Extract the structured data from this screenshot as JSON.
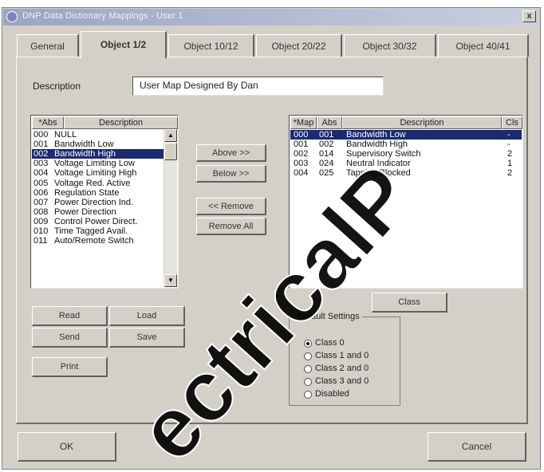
{
  "window": {
    "title": "DNP Data Dictionary Mappings - User 1",
    "close_label": "x"
  },
  "tabs": [
    {
      "label": "General"
    },
    {
      "label": "Object 1/2"
    },
    {
      "label": "Object 10/12"
    },
    {
      "label": "Object 20/22"
    },
    {
      "label": "Object 30/32"
    },
    {
      "label": "Object 40/41"
    }
  ],
  "description": {
    "label": "Description",
    "value": "User Map Designed By Dan"
  },
  "source_list": {
    "columns": [
      "*Abs",
      "Description"
    ],
    "rows": [
      {
        "abs": "000",
        "desc": "NULL"
      },
      {
        "abs": "001",
        "desc": "Bandwidth Low"
      },
      {
        "abs": "002",
        "desc": "Bandwidth High"
      },
      {
        "abs": "003",
        "desc": "Voltage Limiting Low"
      },
      {
        "abs": "004",
        "desc": "Voltage Limiting High"
      },
      {
        "abs": "005",
        "desc": "Voltage Red. Active"
      },
      {
        "abs": "006",
        "desc": "Regulation State"
      },
      {
        "abs": "007",
        "desc": "Power Direction Ind."
      },
      {
        "abs": "008",
        "desc": "Power Direction"
      },
      {
        "abs": "009",
        "desc": "Control Power Direct."
      },
      {
        "abs": "010",
        "desc": "Time Tagged Avail."
      },
      {
        "abs": "011",
        "desc": "Auto/Remote Switch"
      }
    ]
  },
  "map_list": {
    "columns": [
      "*Map",
      "Abs",
      "Description",
      "Cls"
    ],
    "rows": [
      {
        "map": "000",
        "abs": "001",
        "desc": "Bandwidth Low",
        "cls": "-"
      },
      {
        "map": "001",
        "abs": "002",
        "desc": "Bandwidth High",
        "cls": "-"
      },
      {
        "map": "002",
        "abs": "014",
        "desc": "Supervisory Switch",
        "cls": "2"
      },
      {
        "map": "003",
        "abs": "024",
        "desc": "Neutral Indicator",
        "cls": "1"
      },
      {
        "map": "004",
        "abs": "025",
        "desc": "Tapping Blocked",
        "cls": "2"
      }
    ]
  },
  "buttons": {
    "above": "Above >>",
    "below": "Below >>",
    "remove": "<< Remove",
    "remove_all": "Remove All",
    "read": "Read",
    "load": "Load",
    "send": "Send",
    "save": "Save",
    "print": "Print",
    "class": "Class",
    "ok": "OK",
    "cancel": "Cancel"
  },
  "default_settings": {
    "title": "Default Settings",
    "options": [
      "Class 0",
      "Class 1 and 0",
      "Class 2 and 0",
      "Class 3 and 0",
      "Disabled"
    ],
    "selected": "Class 0"
  },
  "watermark": {
    "text": "ElectricalPartManuals",
    "color": "#000000"
  },
  "colors": {
    "dialog": "#d4d0c8",
    "selection": "#1c2a70",
    "titlebar": "#98a6c4"
  }
}
